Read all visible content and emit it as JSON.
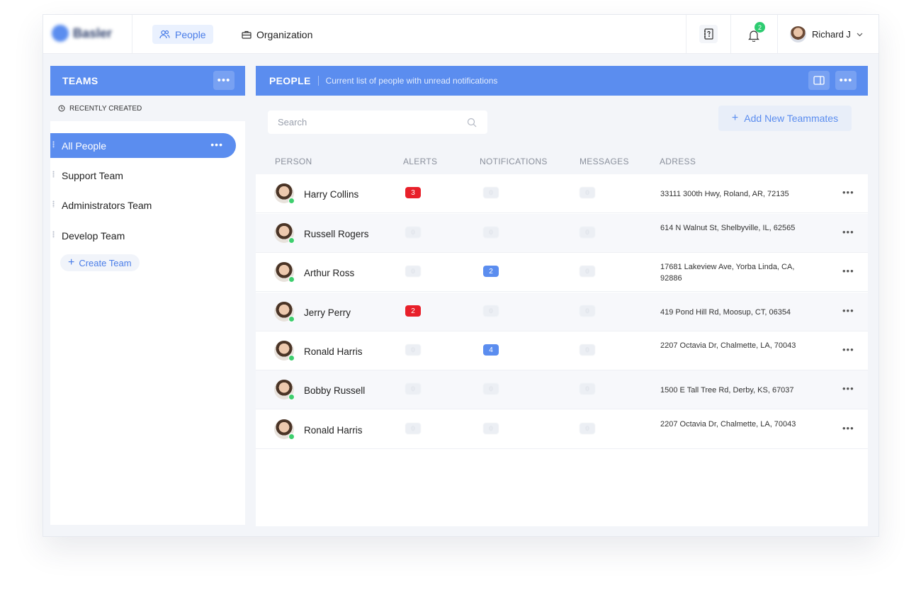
{
  "header": {
    "logo_text": "Basler",
    "nav": {
      "people_label": "People",
      "organization_label": "Organization"
    },
    "notifications_count": "2",
    "user_name": "Richard J"
  },
  "teams": {
    "title": "TEAMS",
    "recent_label": "RECENTLY CREATED",
    "items": [
      {
        "label": "All People"
      },
      {
        "label": "Support Team"
      },
      {
        "label": "Administrators Team"
      },
      {
        "label": "Develop Team"
      }
    ],
    "create_label": "Create Team"
  },
  "people": {
    "title": "PEOPLE",
    "subtitle": "Current list of people with unread notifications",
    "search_placeholder": "Search",
    "add_label": "Add New Teammates",
    "columns": {
      "person": "PERSON",
      "alerts": "ALERTS",
      "notifications": "NOTIFICATIONS",
      "messages": "MESSAGES",
      "address": "ADRESS"
    },
    "rows": [
      {
        "name": "Harry Collins",
        "alerts": "3",
        "notifications": "0",
        "messages": "0",
        "address": "33111 300th Hwy, Roland, AR, 72135"
      },
      {
        "name": "Russell Rogers",
        "alerts": "0",
        "notifications": "0",
        "messages": "0",
        "address": "614 N Walnut St, Shelbyville, IL, 62565"
      },
      {
        "name": "Arthur Ross",
        "alerts": "0",
        "notifications": "2",
        "messages": "0",
        "address": "17681 Lakeview Ave, Yorba Linda, CA, 92886"
      },
      {
        "name": "Jerry Perry",
        "alerts": "2",
        "notifications": "0",
        "messages": "0",
        "address": "419 Pond Hill Rd, Moosup, CT, 06354"
      },
      {
        "name": "Ronald Harris",
        "alerts": "0",
        "notifications": "4",
        "messages": "0",
        "address": "2207 Octavia Dr, Chalmette, LA, 70043"
      },
      {
        "name": "Bobby Russell",
        "alerts": "0",
        "notifications": "0",
        "messages": "0",
        "address": "1500 E Tall Tree Rd, Derby, KS, 67037"
      },
      {
        "name": "Ronald Harris",
        "alerts": "0",
        "notifications": "0",
        "messages": "0",
        "address": "2207 Octavia Dr, Chalmette, LA, 70043"
      }
    ]
  },
  "colors": {
    "accent": "#5b8def",
    "alert": "#e8202a",
    "online": "#3ecf6e"
  }
}
